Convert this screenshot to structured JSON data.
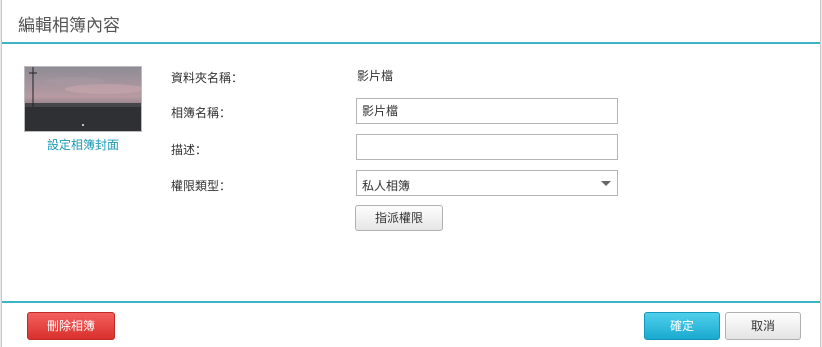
{
  "dialog": {
    "title": "編輯相簿內容",
    "cover_link": "設定相簿封面",
    "fields": {
      "folder_name_label": "資料夾名稱：",
      "folder_name_value": "影片檔",
      "album_name_label": "相簿名稱：",
      "album_name_value": "影片檔",
      "description_label": "描述：",
      "description_value": "",
      "permission_type_label": "權限類型：",
      "permission_type_value": "私人相簿"
    },
    "assign_permission_label": "指派權限",
    "footer": {
      "delete_label": "刪除相簿",
      "ok_label": "確定",
      "cancel_label": "取消"
    }
  },
  "colors": {
    "accent": "#3cb4c6",
    "link": "#1b9ab4",
    "danger": "#d92f2c",
    "primary": "#1aa9cf"
  }
}
